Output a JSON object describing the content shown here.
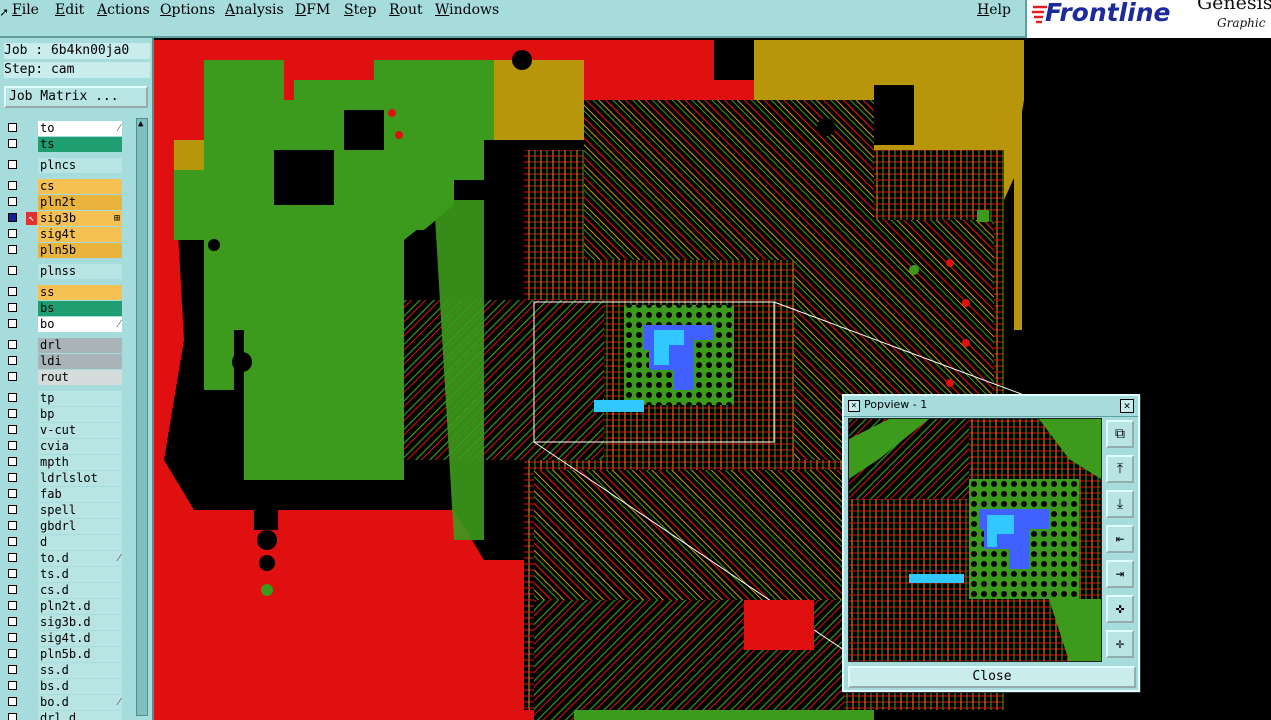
{
  "menubar": {
    "items": [
      "File",
      "Edit",
      "Actions",
      "Options",
      "Analysis",
      "DFM",
      "Step",
      "Rout",
      "Windows"
    ],
    "help": "Help"
  },
  "brand": {
    "logo": "Frontline",
    "product": "Genesis",
    "tagline": "Graphic"
  },
  "left": {
    "job": "Job : 6b4kn00ja0",
    "step": "Step: cam",
    "job_matrix": "Job Matrix ...",
    "layers": [
      {
        "name": "to",
        "color": "#ffffff",
        "mark": "⁄"
      },
      {
        "name": "ts",
        "color": "#1f9e72"
      },
      {
        "name": "plncs",
        "color": "#b8e4e4"
      },
      {
        "name": "cs",
        "color": "#f4c152"
      },
      {
        "name": "pln2t",
        "color": "#e9b33c"
      },
      {
        "name": "sig3b",
        "color": "#f4c152",
        "selected": true,
        "mark": "⊞"
      },
      {
        "name": "sig4t",
        "color": "#f4c152"
      },
      {
        "name": "pln5b",
        "color": "#e9b33c"
      },
      {
        "name": "plnss",
        "color": "#b8e4e4"
      },
      {
        "name": "ss",
        "color": "#f4c152"
      },
      {
        "name": "bs",
        "color": "#1f9e72"
      },
      {
        "name": "bo",
        "color": "#ffffff",
        "mark": "⁄"
      },
      {
        "name": "drl",
        "color": "#a9b4b8"
      },
      {
        "name": "ldi",
        "color": "#a9b4b8"
      },
      {
        "name": "rout",
        "color": "#d5dcdc"
      },
      {
        "name": "tp",
        "color": "#b8e4e4"
      },
      {
        "name": "bp",
        "color": "#b8e4e4"
      },
      {
        "name": "v-cut",
        "color": "#b8e4e4"
      },
      {
        "name": "cvia",
        "color": "#b8e4e4"
      },
      {
        "name": "mpth",
        "color": "#b8e4e4"
      },
      {
        "name": "ldrlslot",
        "color": "#b8e4e4"
      },
      {
        "name": "fab",
        "color": "#b8e4e4"
      },
      {
        "name": "spell",
        "color": "#b8e4e4"
      },
      {
        "name": "gbdrl",
        "color": "#b8e4e4"
      },
      {
        "name": "d",
        "color": "#b8e4e4"
      },
      {
        "name": "to.d",
        "color": "#b8e4e4",
        "mark": "⁄"
      },
      {
        "name": "ts.d",
        "color": "#b8e4e4"
      },
      {
        "name": "cs.d",
        "color": "#b8e4e4"
      },
      {
        "name": "pln2t.d",
        "color": "#b8e4e4"
      },
      {
        "name": "sig3b.d",
        "color": "#b8e4e4"
      },
      {
        "name": "sig4t.d",
        "color": "#b8e4e4"
      },
      {
        "name": "pln5b.d",
        "color": "#b8e4e4"
      },
      {
        "name": "ss.d",
        "color": "#b8e4e4"
      },
      {
        "name": "bs.d",
        "color": "#b8e4e4"
      },
      {
        "name": "bo.d",
        "color": "#b8e4e4",
        "mark": "⁄"
      },
      {
        "name": "drl.d",
        "color": "#b8e4e4"
      }
    ]
  },
  "popview": {
    "title": "Popview - 1",
    "close_label": "Close",
    "tools": [
      "zoom-fit-icon",
      "pan-up-icon",
      "pan-down-icon",
      "pan-left-icon",
      "pan-right-icon",
      "zoom-in-icon",
      "zoom-out-icon"
    ]
  },
  "colors": {
    "panel_bg": "#a6dcdc",
    "copper_red": "#e01010",
    "copper_green": "#3c9a1c",
    "copper_gold": "#b8960c",
    "highlight_blue": "#4060ff",
    "highlight_cyan": "#30c8ff"
  }
}
